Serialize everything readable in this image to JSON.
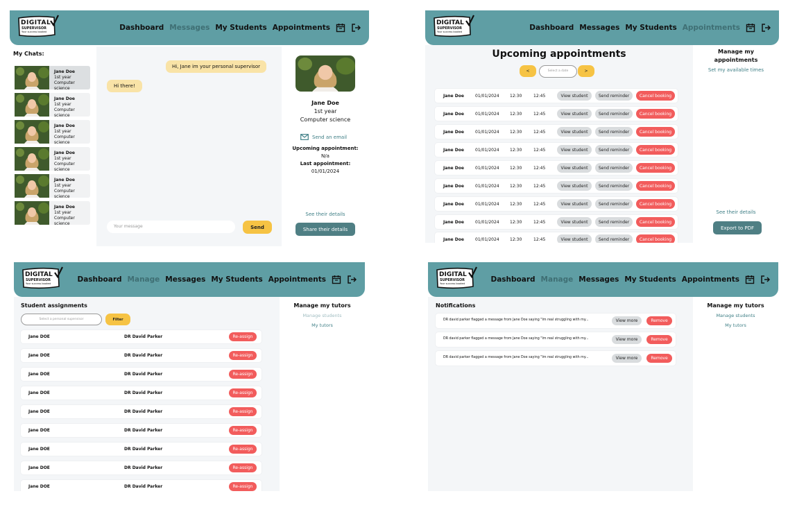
{
  "brand": {
    "line1": "DIGITAL",
    "line2": "SUPERVISOR",
    "tagline": "Your success booked"
  },
  "panel1": {
    "nav": [
      "Dashboard",
      "Messages",
      "My Students",
      "Appointments"
    ],
    "my_chats": "My Chats:",
    "chats": [
      {
        "name": "Jane Doe",
        "year": "1st year",
        "course": "Computer science"
      },
      {
        "name": "Jane Doe",
        "year": "1st year",
        "course": "Computer science"
      },
      {
        "name": "Jane Doe",
        "year": "1st year",
        "course": "Computer science"
      },
      {
        "name": "Jane Doe",
        "year": "1st year",
        "course": "Computer science"
      },
      {
        "name": "Jane Doe",
        "year": "1st year",
        "course": "Computer science"
      },
      {
        "name": "Jane Doe",
        "year": "1st year",
        "course": "Computer science"
      }
    ],
    "msg_out": "Hi, Jane im your personal supervisor",
    "msg_in": "Hi there!",
    "input_placeholder": "Your message",
    "send": "Send",
    "profile": {
      "name": "Jane Doe",
      "year": "1st year",
      "course": "Computer science",
      "email": "Send an email",
      "upcoming_label": "Upcoming appointment:",
      "upcoming_value": "N/a",
      "last_label": "Last appointment:",
      "last_value": "01/01/2024",
      "see_details": "See their details",
      "share": "Share their details"
    }
  },
  "panel2": {
    "nav": [
      "Dashboard",
      "Messages",
      "My Students",
      "Appointments"
    ],
    "title": "Upcoming appointments",
    "prev": "<",
    "next": ">",
    "date_placeholder": "Select a date",
    "rows": [
      {
        "name": "Jane Doe",
        "date": "01/01/2024",
        "start": "12:30",
        "end": "12:45"
      },
      {
        "name": "Jane Doe",
        "date": "01/01/2024",
        "start": "12:30",
        "end": "12:45"
      },
      {
        "name": "Jane Doe",
        "date": "01/01/2024",
        "start": "12:30",
        "end": "12:45"
      },
      {
        "name": "Jane Doe",
        "date": "01/01/2024",
        "start": "12:30",
        "end": "12:45"
      },
      {
        "name": "Jane Doe",
        "date": "01/01/2024",
        "start": "12:30",
        "end": "12:45"
      },
      {
        "name": "Jane Doe",
        "date": "01/01/2024",
        "start": "12:30",
        "end": "12:45"
      },
      {
        "name": "Jane Doe",
        "date": "01/01/2024",
        "start": "12:30",
        "end": "12:45"
      },
      {
        "name": "Jane Doe",
        "date": "01/01/2024",
        "start": "12:30",
        "end": "12:45"
      },
      {
        "name": "Jane Doe",
        "date": "01/01/2024",
        "start": "12:30",
        "end": "12:45"
      }
    ],
    "view_student": "View student",
    "send_reminder": "Send reminder",
    "cancel_booking": "Cancel booking",
    "side_title": "Manage my appointments",
    "side_link": "Set my available times",
    "see_details": "See their details",
    "export": "Export to PDF"
  },
  "panel3": {
    "nav": [
      "Dashboard",
      "Manage",
      "Messages",
      "My Students",
      "Appointments"
    ],
    "title": "Student assignments",
    "select_placeholder": "Select a personal supervisor",
    "filter": "Filter",
    "rows": [
      {
        "student": "Jane DOE",
        "supervisor": "DR David Parker"
      },
      {
        "student": "Jane DOE",
        "supervisor": "DR David Parker"
      },
      {
        "student": "Jane DOE",
        "supervisor": "DR David Parker"
      },
      {
        "student": "Jane DOE",
        "supervisor": "DR David Parker"
      },
      {
        "student": "Jane DOE",
        "supervisor": "DR David Parker"
      },
      {
        "student": "Jane DOE",
        "supervisor": "DR David Parker"
      },
      {
        "student": "Jane DOE",
        "supervisor": "DR David Parker"
      },
      {
        "student": "Jane DOE",
        "supervisor": "DR David Parker"
      },
      {
        "student": "Jane DOE",
        "supervisor": "DR David Parker"
      }
    ],
    "reassign": "Re-assign",
    "side_title": "Manage my tutors",
    "side_link1": "Manage students",
    "side_link2": "My tutors"
  },
  "panel4": {
    "nav": [
      "Dashboard",
      "Manage",
      "Messages",
      "My Students",
      "Appointments"
    ],
    "title": "Notifications",
    "rows": [
      {
        "text": "DR david parker flagged a message from Jane Doe saying \"Im real struggling with my..."
      },
      {
        "text": "DR david parker flagged a message from Jane Doe saying \"Im real struggling with my..."
      },
      {
        "text": "DR david parker flagged a message from Jane Doe saying \"Im real struggling with my..."
      }
    ],
    "view_more": "View more",
    "remove": "Remove",
    "side_title": "Manage my tutors",
    "side_link1": "Manage students",
    "side_link2": "My tutors"
  },
  "colors": {
    "teal": "#5f9ea4",
    "yellow": "#f6c344",
    "red": "#f25c5c",
    "grey": "#d9dcde",
    "panel_bg": "#f4f6f8"
  }
}
